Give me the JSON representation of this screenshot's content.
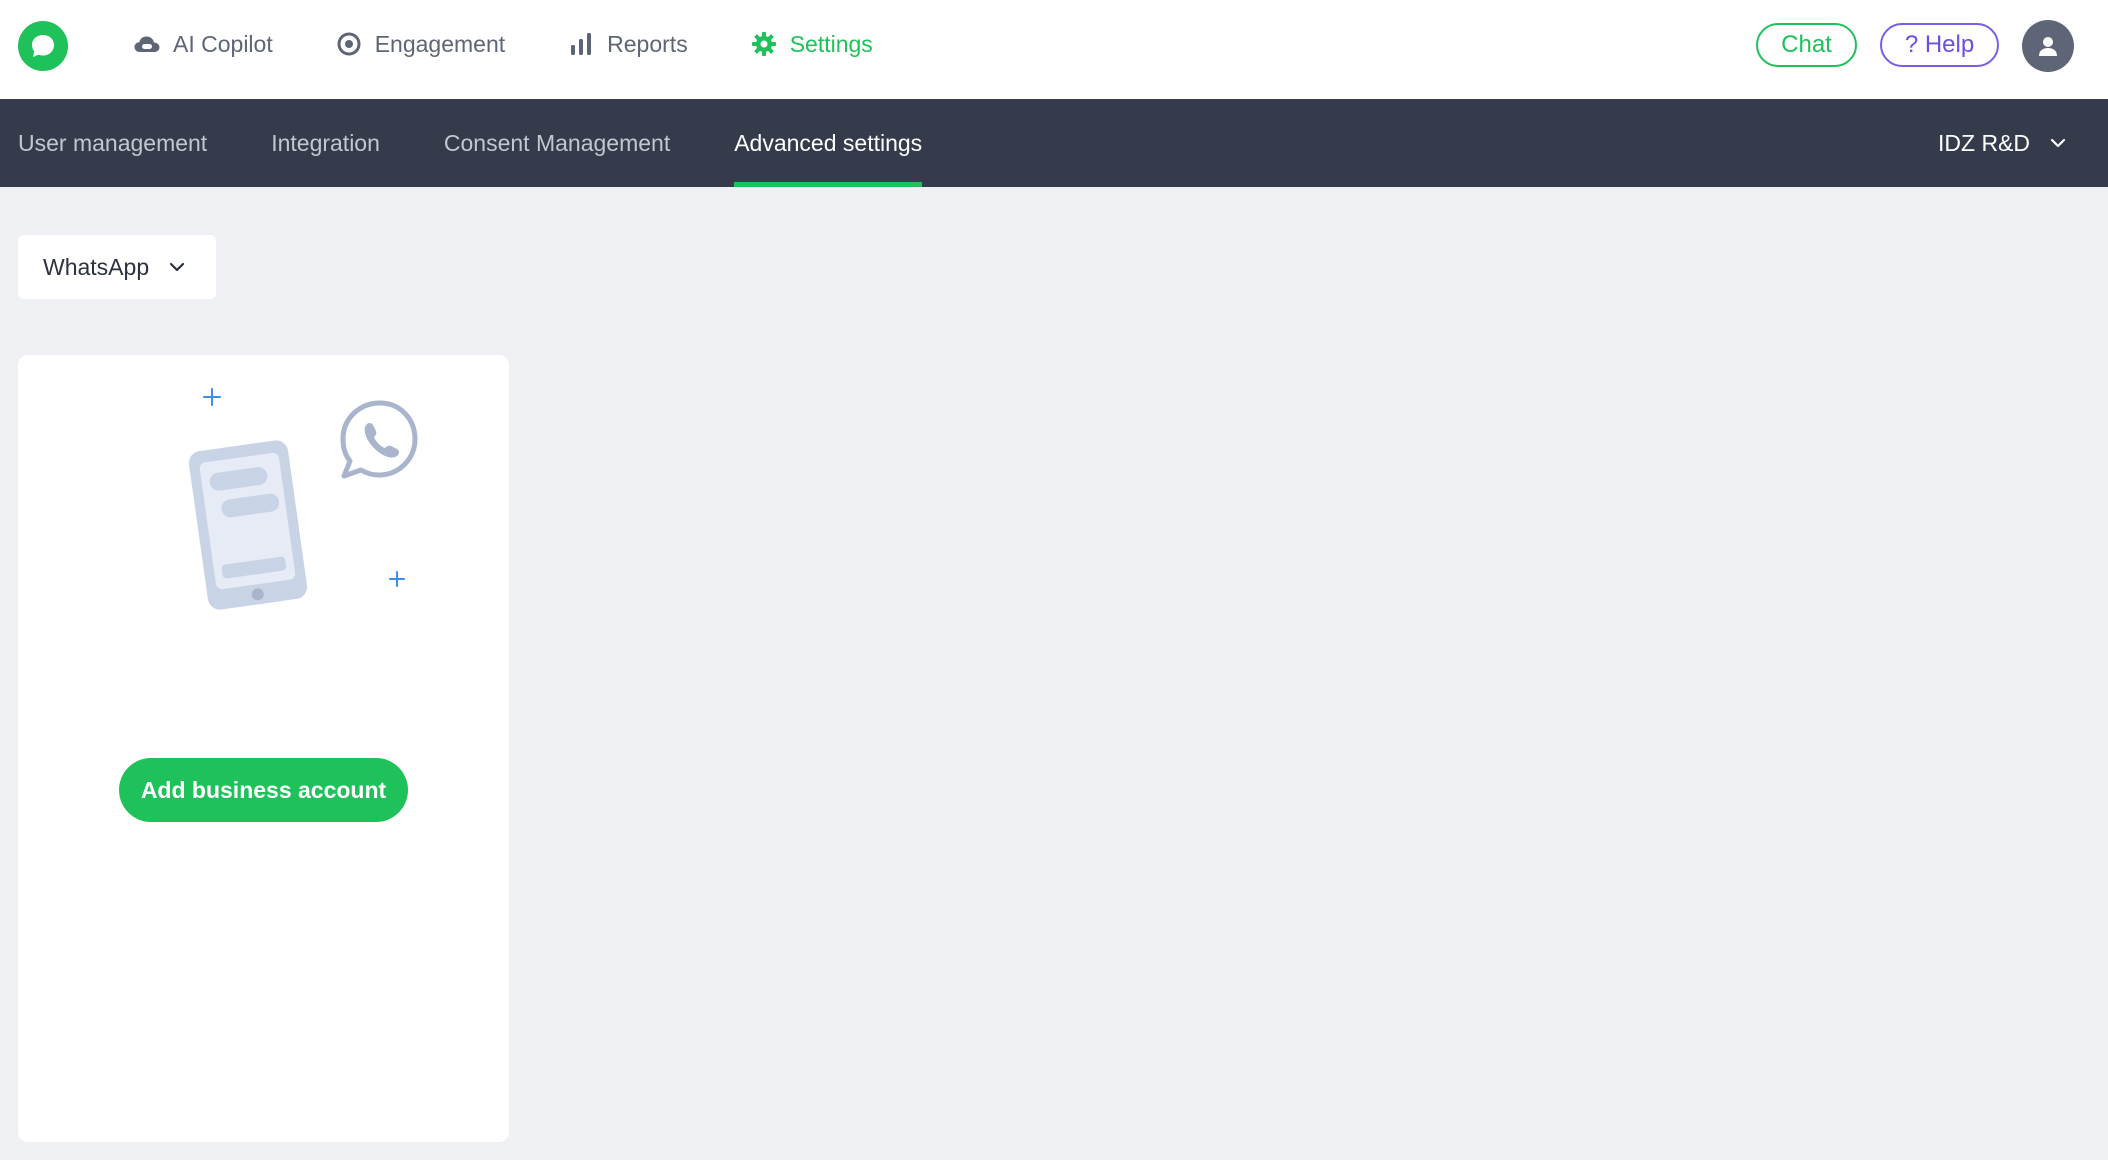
{
  "header": {
    "nav": [
      {
        "label": "AI Copilot",
        "icon": "cloud-icon"
      },
      {
        "label": "Engagement",
        "icon": "target-icon"
      },
      {
        "label": "Reports",
        "icon": "bar-chart-icon"
      },
      {
        "label": "Settings",
        "icon": "gear-icon",
        "active": true
      }
    ],
    "chat_label": "Chat",
    "help_label": "? Help"
  },
  "subnav": {
    "tabs": [
      {
        "label": "User management"
      },
      {
        "label": "Integration"
      },
      {
        "label": "Consent Management"
      },
      {
        "label": "Advanced settings",
        "active": true
      }
    ],
    "org_label": "IDZ R&D"
  },
  "main": {
    "channel_select": {
      "value": "WhatsApp"
    },
    "card": {
      "button_label": "Add business account"
    }
  },
  "colors": {
    "accent": "#1ec15a",
    "help": "#6b4fe0",
    "subnav_bg": "#353b4b",
    "page_bg": "#eef0f4"
  }
}
